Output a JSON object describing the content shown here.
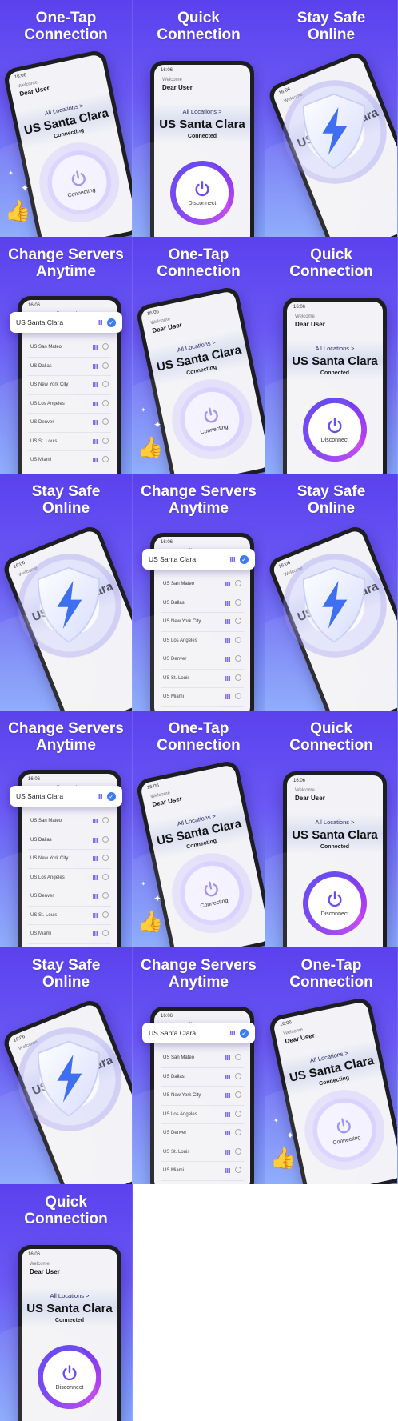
{
  "common": {
    "status_time": "16:06",
    "welcome": "Welcome",
    "user": "Dear User",
    "all_locations": "All Locations >",
    "location": "US Santa Clara",
    "connecting": "Connecting",
    "connected": "Connected",
    "disconnect": "Disconnect",
    "list_title": "All Locations",
    "selected_server": "US Santa Clara",
    "servers": [
      "US San Mateo",
      "US Dallas",
      "US New York City",
      "US Los Angeles",
      "US Denver",
      "US St. Louis",
      "US Miami"
    ]
  },
  "cards": [
    {
      "type": "onetap",
      "title": "One-Tap Connection"
    },
    {
      "type": "quick",
      "title": "Quick Connection"
    },
    {
      "type": "safe",
      "title": "Stay Safe Online"
    },
    {
      "type": "servers",
      "title": "Change Servers Anytime"
    },
    {
      "type": "onetap",
      "title": "One-Tap Connection"
    },
    {
      "type": "quick",
      "title": "Quick Connection"
    },
    {
      "type": "safe",
      "title": "Stay Safe Online"
    },
    {
      "type": "servers",
      "title": "Change Servers Anytime"
    },
    {
      "type": "safe",
      "title": "Stay Safe Online"
    },
    {
      "type": "servers",
      "title": "Change Servers Anytime"
    },
    {
      "type": "onetap",
      "title": "One-Tap Connection"
    },
    {
      "type": "quick",
      "title": "Quick Connection"
    },
    {
      "type": "safe",
      "title": "Stay Safe Online"
    },
    {
      "type": "servers",
      "title": "Change Servers Anytime"
    },
    {
      "type": "onetap",
      "title": "One-Tap Connection"
    },
    {
      "type": "quick",
      "title": "Quick Connection"
    }
  ],
  "colors": {
    "accent": "#5b41ee",
    "ring_pink": "#c13ef2",
    "check_blue": "#3d7bf0",
    "shield_bolt": "#3d6ff0"
  },
  "icons": {
    "power": "power-icon",
    "thumbs_up": "thumbs-up-icon",
    "sparkle": "sparkle-icon",
    "shield": "shield-icon",
    "bolt": "lightning-icon",
    "check": "check-icon",
    "signal": "signal-icon"
  }
}
